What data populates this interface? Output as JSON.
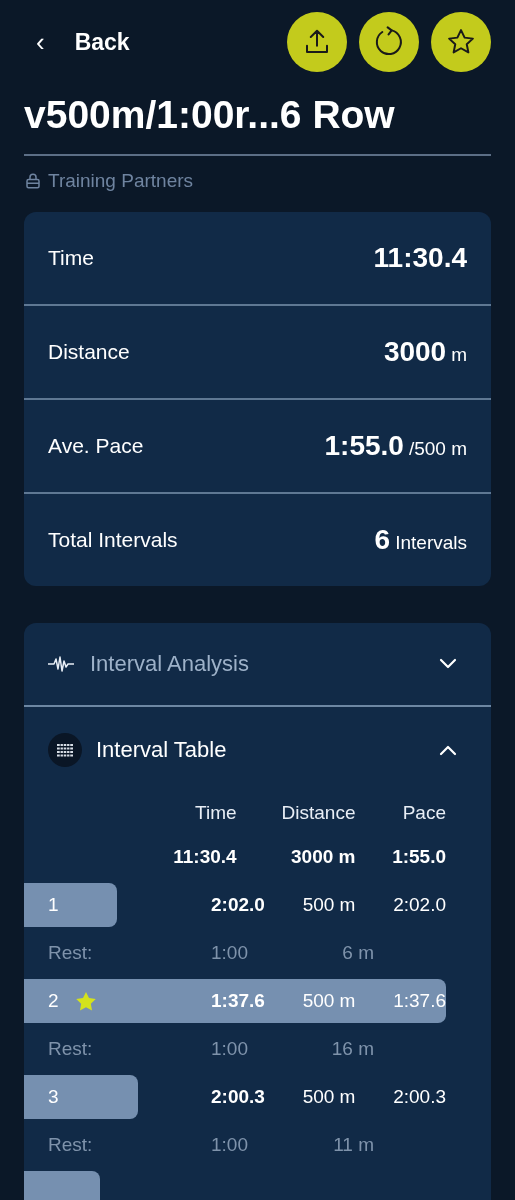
{
  "header": {
    "back": {
      "icon": "‹",
      "label": "Back"
    },
    "actions": [
      {
        "kind": "share"
      },
      {
        "kind": "refresh"
      },
      {
        "kind": "favorite"
      }
    ]
  },
  "title": "v500m/1:00r...6 Row",
  "visibility": "Training Partners",
  "summary": [
    {
      "label": "Time",
      "value": "11:30.4"
    },
    {
      "label": "Distance",
      "value": "3000",
      "unit": "m"
    },
    {
      "label": "Ave. Pace",
      "value": "1:55.0",
      "unit": "/500 m"
    },
    {
      "label": "Total Intervals",
      "value": "6",
      "unit": "Intervals"
    }
  ],
  "sections": [
    {
      "kind": "analysis",
      "title": "Interval Analysis",
      "expanded": false
    },
    {
      "kind": "table",
      "title": "Interval Table",
      "expanded": true
    }
  ],
  "table": {
    "columns": [
      "Time",
      "Distance",
      "Pace"
    ],
    "totals": [
      "11:30.4",
      "3000 m",
      "1:55.0"
    ],
    "rows": [
      {
        "kind": "work",
        "label": "1",
        "level": 0.22,
        "best": false,
        "cells": [
          "2:02.0",
          "500 m",
          "2:02.0"
        ]
      },
      {
        "kind": "rest",
        "label": "Rest:",
        "cells": [
          "1:00",
          "6 m"
        ]
      },
      {
        "kind": "work",
        "label": "2",
        "level": 1,
        "best": true,
        "cells": [
          "1:37.6",
          "500 m",
          "1:37.6"
        ]
      },
      {
        "kind": "rest",
        "label": "Rest:",
        "cells": [
          "1:00",
          "16 m"
        ]
      },
      {
        "kind": "work",
        "label": "3",
        "level": 0.27,
        "best": false,
        "cells": [
          "2:00.3",
          "500 m",
          "2:00.3"
        ]
      },
      {
        "kind": "rest",
        "label": "Rest:",
        "cells": [
          "1:00",
          "11 m"
        ]
      },
      {
        "kind": "work",
        "level": 0.18,
        "best": false,
        "cells": []
      }
    ]
  }
}
